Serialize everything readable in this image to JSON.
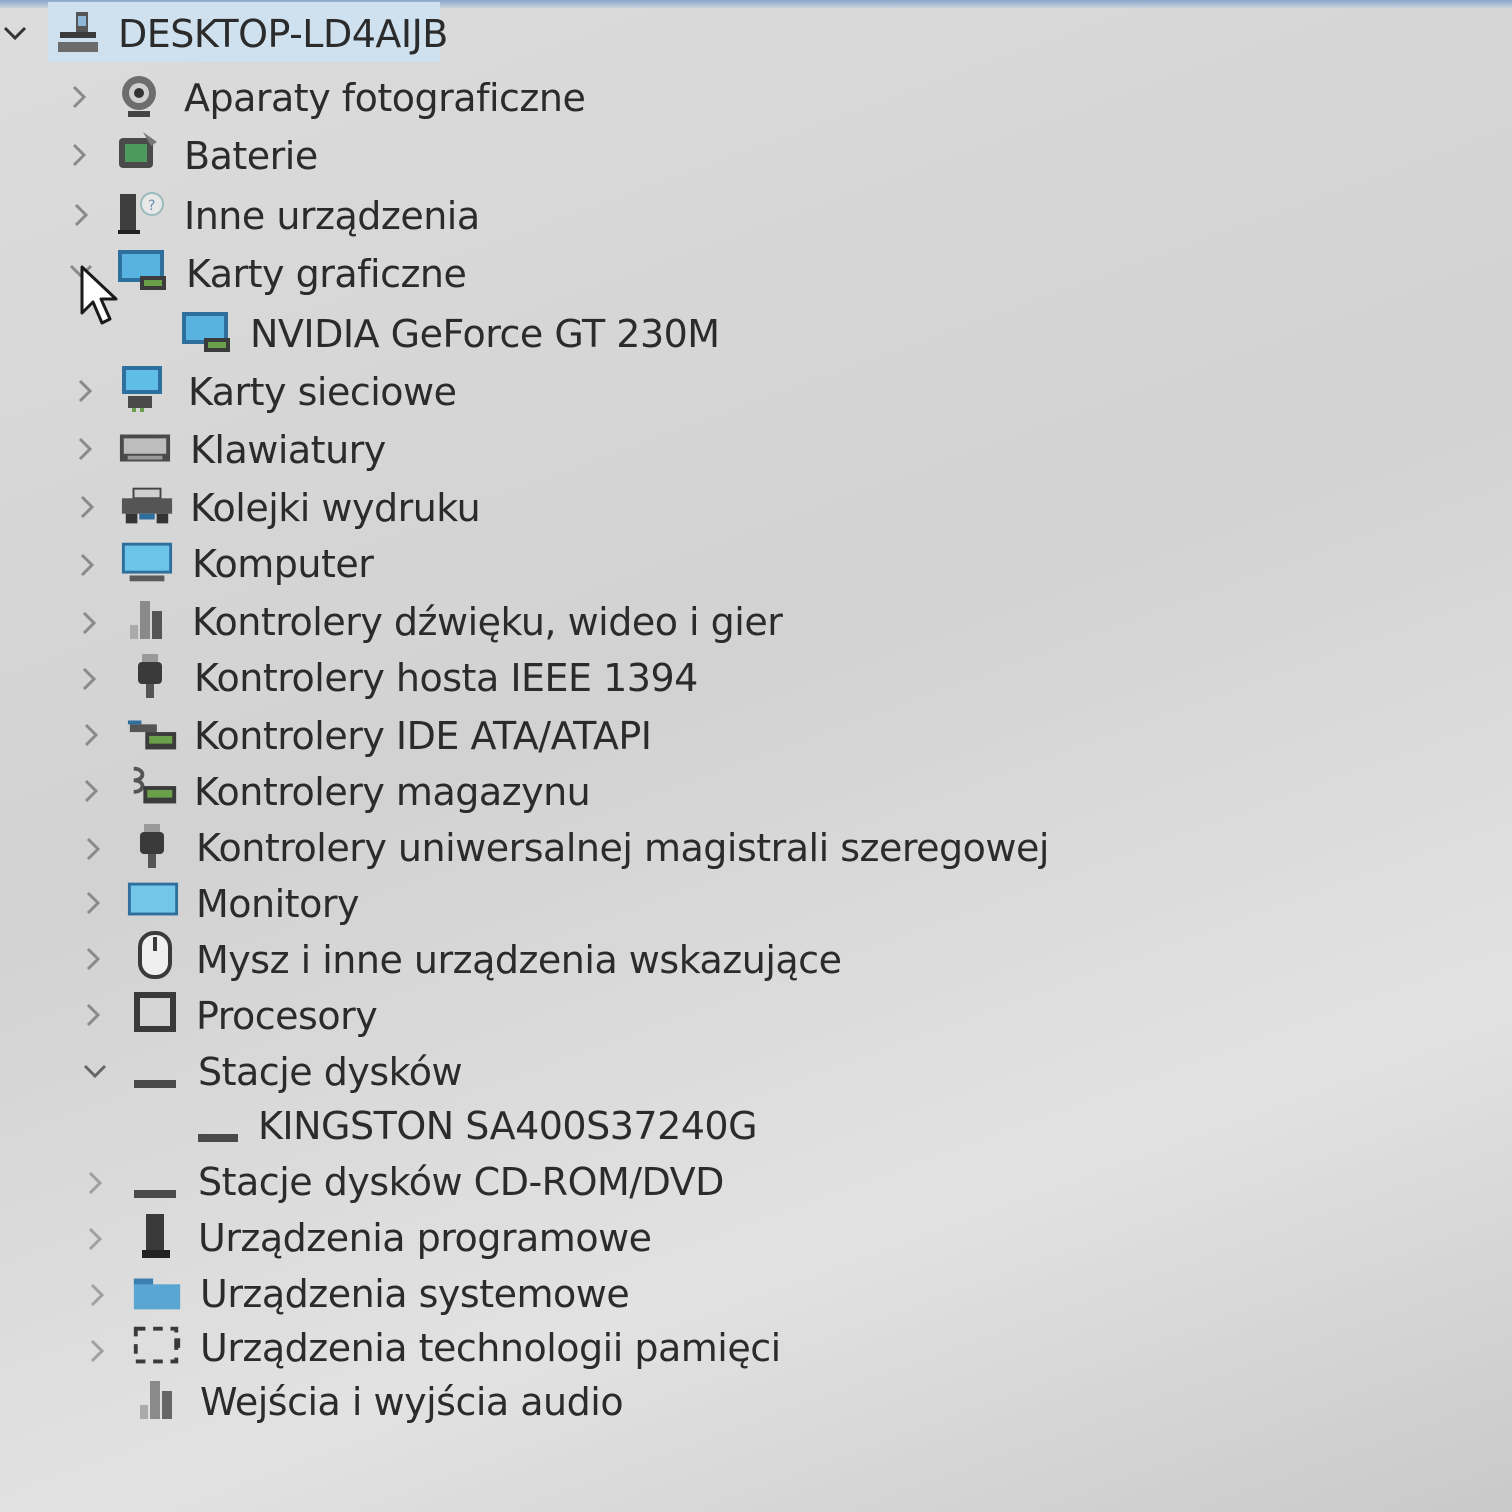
{
  "root": {
    "label": "DESKTOP-LD4AIJB",
    "expanded": true,
    "icon": "computer-icon"
  },
  "items": [
    {
      "label": "Aparaty fotograficzne",
      "icon": "camera-icon",
      "expanded": false
    },
    {
      "label": "Baterie",
      "icon": "battery-icon",
      "expanded": false
    },
    {
      "label": "Inne urządzenia",
      "icon": "unknown-device-icon",
      "expanded": false
    },
    {
      "label": "Karty graficzne",
      "icon": "display-adapter-icon",
      "expanded": true,
      "children": [
        {
          "label": "NVIDIA GeForce GT 230M",
          "icon": "display-adapter-icon"
        }
      ]
    },
    {
      "label": "Karty sieciowe",
      "icon": "network-adapter-icon",
      "expanded": false
    },
    {
      "label": "Klawiatury",
      "icon": "keyboard-icon",
      "expanded": false
    },
    {
      "label": "Kolejki wydruku",
      "icon": "printer-icon",
      "expanded": false
    },
    {
      "label": "Komputer",
      "icon": "monitor-icon",
      "expanded": false
    },
    {
      "label": "Kontrolery dźwięku, wideo i gier",
      "icon": "speaker-icon",
      "expanded": false
    },
    {
      "label": "Kontrolery hosta IEEE 1394",
      "icon": "connector-icon",
      "expanded": false
    },
    {
      "label": "Kontrolery IDE ATA/ATAPI",
      "icon": "ide-controller-icon",
      "expanded": false
    },
    {
      "label": "Kontrolery magazynu",
      "icon": "storage-controller-icon",
      "expanded": false
    },
    {
      "label": "Kontrolery uniwersalnej magistrali szeregowej",
      "icon": "usb-icon",
      "expanded": false
    },
    {
      "label": "Monitory",
      "icon": "monitor-icon",
      "expanded": false
    },
    {
      "label": "Mysz i inne urządzenia wskazujące",
      "icon": "mouse-icon",
      "expanded": false
    },
    {
      "label": "Procesory",
      "icon": "processor-icon",
      "expanded": false
    },
    {
      "label": "Stacje dysków",
      "icon": "disk-drive-icon",
      "expanded": true,
      "children": [
        {
          "label": "KINGSTON SA400S37240G",
          "icon": "disk-drive-icon"
        }
      ]
    },
    {
      "label": "Stacje dysków CD-ROM/DVD",
      "icon": "disk-drive-icon",
      "expanded": false
    },
    {
      "label": "Urządzenia programowe",
      "icon": "software-device-icon",
      "expanded": false
    },
    {
      "label": "Urządzenia systemowe",
      "icon": "folder-icon",
      "expanded": false
    },
    {
      "label": "Urządzenia technologii pamięci",
      "icon": "memory-icon",
      "expanded": false
    },
    {
      "label": "Wejścia i wyjścia audio",
      "icon": "speaker-icon",
      "expanded": false
    }
  ],
  "colors": {
    "selection": "#cfe0ee",
    "icon_blue": "#3f8fc6",
    "text": "#2b2b2b"
  }
}
